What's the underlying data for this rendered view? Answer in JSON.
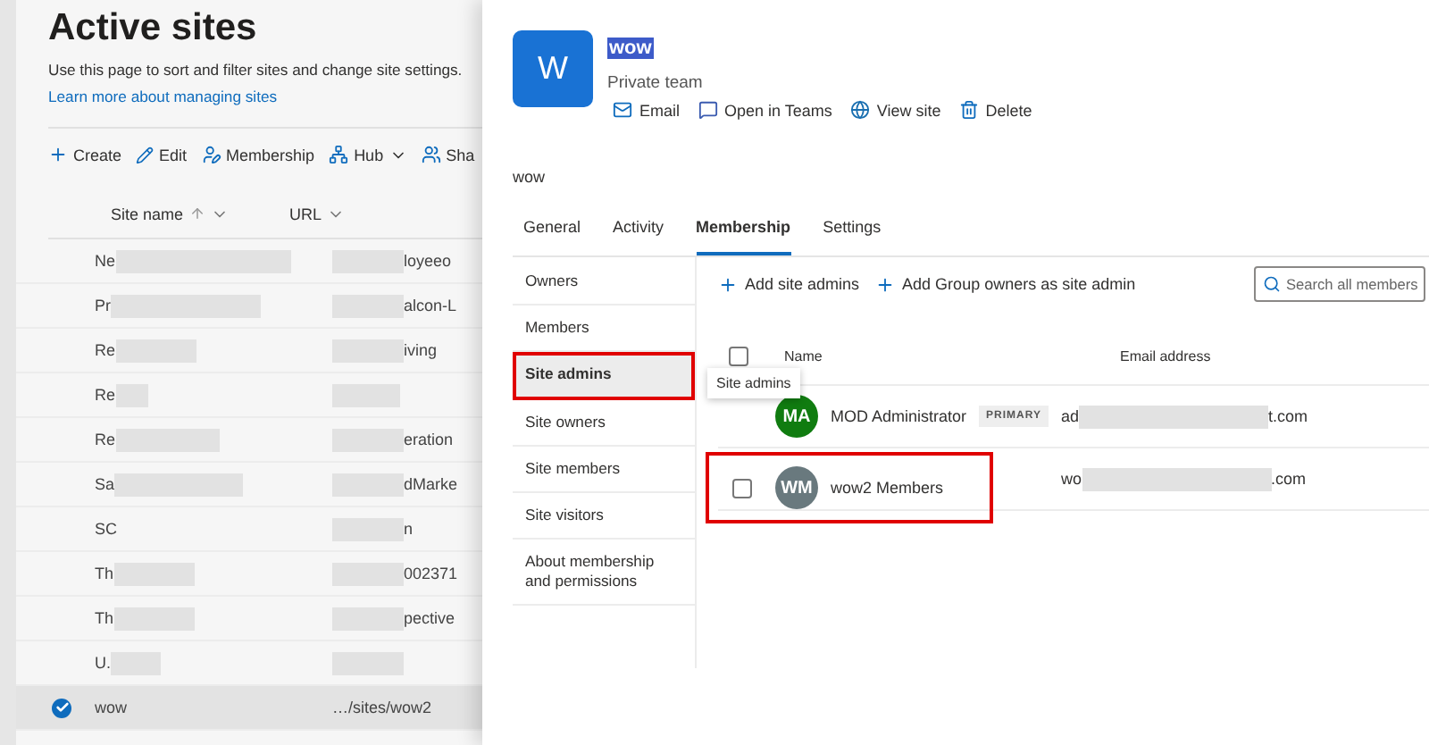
{
  "page": {
    "title": "Active sites",
    "description": "Use this page to sort and filter sites and change site settings.",
    "link": "Learn more about managing sites",
    "toolbar": [
      {
        "kind": "plus",
        "label": "Create"
      },
      {
        "kind": "pencil",
        "label": "Edit"
      },
      {
        "kind": "person",
        "label": "Membership"
      },
      {
        "kind": "hub",
        "label": "Hub",
        "dropdown": true
      },
      {
        "kind": "people",
        "label": "Sha"
      }
    ],
    "columns": [
      {
        "label": "Site name",
        "sorted": true
      },
      {
        "label": "URL",
        "sorted": false
      }
    ],
    "rows": [
      {
        "name": "Ne",
        "url": "loyeeo",
        "selected": false
      },
      {
        "name": "Pr",
        "url": "alcon-L",
        "selected": false
      },
      {
        "name": "Re",
        "url": "iving",
        "selected": false
      },
      {
        "name": "Re",
        "url": "",
        "selected": false
      },
      {
        "name": "Re",
        "url": "eration",
        "selected": false
      },
      {
        "name": "Sa",
        "url": "dMarke",
        "selected": false
      },
      {
        "name": "SC",
        "url": "n",
        "selected": false
      },
      {
        "name": "Th",
        "url": "002371",
        "selected": false
      },
      {
        "name": "Th",
        "url": "pective",
        "selected": false
      },
      {
        "name": "U.",
        "url": "",
        "selected": false
      },
      {
        "name": "wow",
        "url": "…/sites/wow2",
        "selected": true
      }
    ]
  },
  "panel": {
    "avatar": "W",
    "name": "wow",
    "subtitle": "Private team",
    "actions": [
      {
        "kind": "mail",
        "label": "Email"
      },
      {
        "kind": "teams",
        "label": "Open in Teams"
      },
      {
        "kind": "site",
        "label": "View site"
      },
      {
        "kind": "trash",
        "label": "Delete"
      }
    ],
    "description": "wow",
    "tabs": [
      {
        "label": "General",
        "selected": false
      },
      {
        "label": "Activity",
        "selected": false
      },
      {
        "label": "Membership",
        "selected": true
      },
      {
        "label": "Settings",
        "selected": false
      }
    ],
    "nav": [
      {
        "label": "Owners",
        "selected": false,
        "highlighted": false
      },
      {
        "label": "Members",
        "selected": false,
        "highlighted": false
      },
      {
        "label": "Site admins",
        "selected": true,
        "highlighted": true
      },
      {
        "label": "Site owners",
        "selected": false,
        "highlighted": false
      },
      {
        "label": "Site members",
        "selected": false,
        "highlighted": false
      },
      {
        "label": "Site visitors",
        "selected": false,
        "highlighted": false
      },
      {
        "label": "About membership and permissions",
        "selected": false,
        "highlighted": false
      }
    ],
    "tooltip": "Site admins",
    "commands": [
      "Add site admins",
      "Add Group owners as site admin"
    ],
    "search": {
      "placeholder": "Search all members"
    },
    "columns": [
      "Name",
      "Email address"
    ],
    "select_all_checked": false,
    "members": [
      {
        "initials": "MA",
        "color": "#107c10",
        "name": "MOD Administrator",
        "badge": "PRIMARY",
        "email_start": "ad",
        "email_end": "t.com",
        "highlighted": false
      },
      {
        "initials": "WM",
        "color": "#69797e",
        "name": "wow2 Members",
        "email_start": "wo",
        "email_end": ".com",
        "checked": false,
        "highlighted": true
      }
    ]
  }
}
